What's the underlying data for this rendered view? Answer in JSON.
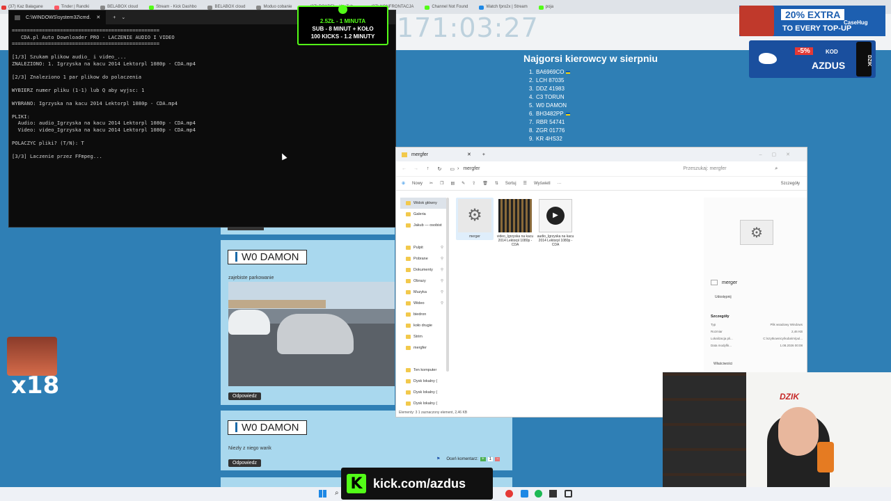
{
  "browser": {
    "tabs": [
      {
        "label": "(37) Kaz Bałagane",
        "color": "#e53935"
      },
      {
        "label": "Tinder | Randki",
        "color": "#ff5864"
      },
      {
        "label": "BELABOX cloud",
        "color": "#888888"
      },
      {
        "label": "Stream - Kick Dashbo",
        "color": "#53fc18"
      },
      {
        "label": "BELABOX cloud",
        "color": "#888888"
      },
      {
        "label": "Moduo cobanie",
        "color": "#888888"
      },
      {
        "label": "(37) BOXDEL - YouTub",
        "color": "#e53935"
      },
      {
        "label": "(37) KONFRONTACJA",
        "color": "#e53935"
      },
      {
        "label": "Channel Not Found",
        "color": "#53fc18"
      },
      {
        "label": "Watch fpro2x | Stream",
        "color": "#1e88e5"
      },
      {
        "label": "poja",
        "color": "#53fc18"
      }
    ]
  },
  "overlay": {
    "clock": "171:03:27",
    "alert_lines": [
      "2.5ZŁ - 1 MINUTA",
      "SUB - 8 MINUT + KOŁO",
      "100 KICKS - 1.2 MINUTY"
    ],
    "promo_text": "20% EXTRA",
    "promo_sub": "TO EVERY TOP-UP",
    "promo_brand": "CaseHug",
    "azdus_discount": "-5%",
    "azdus_kod": "KOD",
    "azdus_code": "AZDUS",
    "azdus_brand": "DZIK",
    "multiplier": "x18",
    "webcam_brand": "DZIK",
    "kick_url": "kick.com/azdus",
    "kick_logo": "K"
  },
  "drivers": {
    "title": "Najgorsi kierowcy w sierpniu",
    "list": [
      {
        "n": "1.",
        "plate": "BA6969CO",
        "flag": true
      },
      {
        "n": "2.",
        "plate": "LCH 87035",
        "flag": false
      },
      {
        "n": "3.",
        "plate": "DDZ 41983",
        "flag": false
      },
      {
        "n": "4.",
        "plate": "C3 TORUN",
        "flag": false
      },
      {
        "n": "5.",
        "plate": "W0 DAMON",
        "flag": false
      },
      {
        "n": "6.",
        "plate": "BH3482PP",
        "flag": true
      },
      {
        "n": "7.",
        "plate": "RBR 54741",
        "flag": false
      },
      {
        "n": "8.",
        "plate": "ZGR 01776",
        "flag": false
      },
      {
        "n": "9.",
        "plate": "KR 4HS32",
        "flag": false
      }
    ]
  },
  "cmd": {
    "title": "C:\\WINDOWS\\system32\\cmd.",
    "lines": [
      "=================================================",
      "   CDA.pl Auto Downloader PRO - LACZENIE AUDIO I VIDEO",
      "=================================================",
      "",
      "[1/3] Szukam plikow audio_ i video_...",
      "ZNALEZIONO: 1. Igrzyska na kacu 2014 Lektorpl 1080p - CDA.mp4",
      "",
      "[2/3] Znaleziono 1 par plikow do polaczenia",
      "",
      "WYBIERZ numer pliku (1-1) lub Q aby wyjsc: 1",
      "",
      "WYBRANO: Igrzyska na kacu 2014 Lektorpl 1080p - CDA.mp4",
      "",
      "PLIKI:",
      "  Audio: audio_Igrzyska na kacu 2014 Lektorpl 1080p - CDA.mp4",
      "  Video: video_Igrzyska na kacu 2014 Lektorpl 1080p - CDA.mp4",
      "",
      "POLACZYC pliki? (T/N): T",
      "",
      "[3/3] Laczenie przez FFmpeg..."
    ]
  },
  "posts": [
    {
      "name": "W0 DAMON",
      "text": "zajebiste parkowanie",
      "reply": "Odpowiedz"
    },
    {
      "name": "W0 DAMON",
      "text": "Niezły z niego warik",
      "reply": "Odpowiedz",
      "rate": "Oceń komentarz:",
      "rate_up": "+",
      "rate_score": "1",
      "rate_down": "−"
    }
  ],
  "explorer": {
    "tab": "mergfer",
    "path": "mergfer",
    "search_placeholder": "Przeszukaj: mergfer",
    "toolbar": {
      "new": "Nowy",
      "sort": "Sortuj",
      "view": "Wyświetl",
      "more": "···",
      "details": "Szczegóły"
    },
    "nav": [
      {
        "label": "Widok główny",
        "pin": false
      },
      {
        "label": "Galeria",
        "pin": false
      },
      {
        "label": "Jakub — osobist",
        "pin": false
      },
      {
        "label": "",
        "pin": false
      },
      {
        "label": "Pulpit",
        "pin": true
      },
      {
        "label": "Pobrane",
        "pin": true
      },
      {
        "label": "Dokumenty",
        "pin": true
      },
      {
        "label": "Obrazy",
        "pin": true
      },
      {
        "label": "Muzyka",
        "pin": true
      },
      {
        "label": "Wideo",
        "pin": true
      },
      {
        "label": "biedron",
        "pin": false
      },
      {
        "label": "koło drugie",
        "pin": false
      },
      {
        "label": "Strim",
        "pin": false
      },
      {
        "label": "mergfer",
        "pin": false
      },
      {
        "label": "",
        "pin": false
      },
      {
        "label": "Ten komputer",
        "pin": false
      },
      {
        "label": "Dysk lokalny (",
        "pin": false
      },
      {
        "label": "Dysk lokalny (",
        "pin": false
      },
      {
        "label": "Dysk lokalny (",
        "pin": false
      }
    ],
    "files": [
      {
        "name": "merger",
        "kind": "bat"
      },
      {
        "name": "video_Igrzyska na kacu 2014 Lektorpl 1080p - CDA",
        "kind": "video"
      },
      {
        "name": "audio_Igrzyska na kacu 2014 Lektorpl 1080p - CDA",
        "kind": "audio"
      }
    ],
    "preview": {
      "name": "merger",
      "share": "Udostępnij",
      "section": "Szczegóły",
      "rows": [
        {
          "k": "Typ",
          "v": "Plik wsadowy Windows"
        },
        {
          "k": "Rozmiar",
          "v": "2,46 KB"
        },
        {
          "k": "Lokalizacja pli...",
          "v": "C:\\szytkownicy\\kuba\\m\\pul..."
        },
        {
          "k": "Data modyfik...",
          "v": "1.08.2026 00:08"
        }
      ],
      "props": "Właściwości"
    },
    "status": "Elementy: 3    1 zaznaczony element, 2,46 KB"
  }
}
